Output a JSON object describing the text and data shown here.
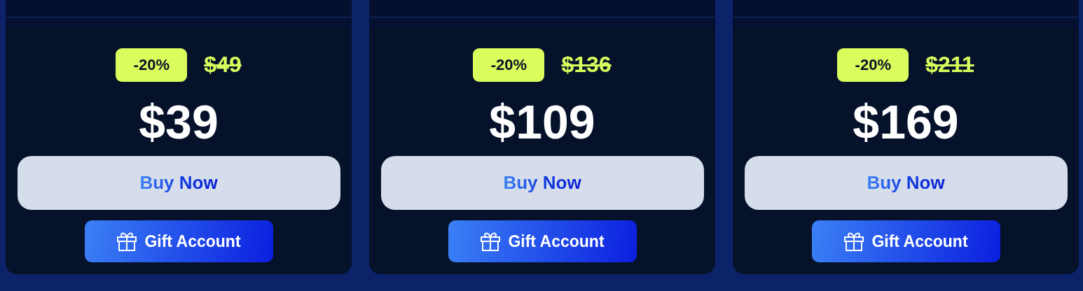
{
  "plans": [
    {
      "discount": "-20%",
      "old_price": "$49",
      "price": "$39",
      "buy_button": "Buy Now",
      "gift_button": "Gift Account"
    },
    {
      "discount": "-20%",
      "old_price": "$136",
      "price": "$109",
      "buy_button": "Buy Now",
      "gift_button": "Gift Account"
    },
    {
      "discount": "-20%",
      "old_price": "$211",
      "price": "$169",
      "buy_button": "Buy Now",
      "gift_button": "Gift Account"
    }
  ]
}
